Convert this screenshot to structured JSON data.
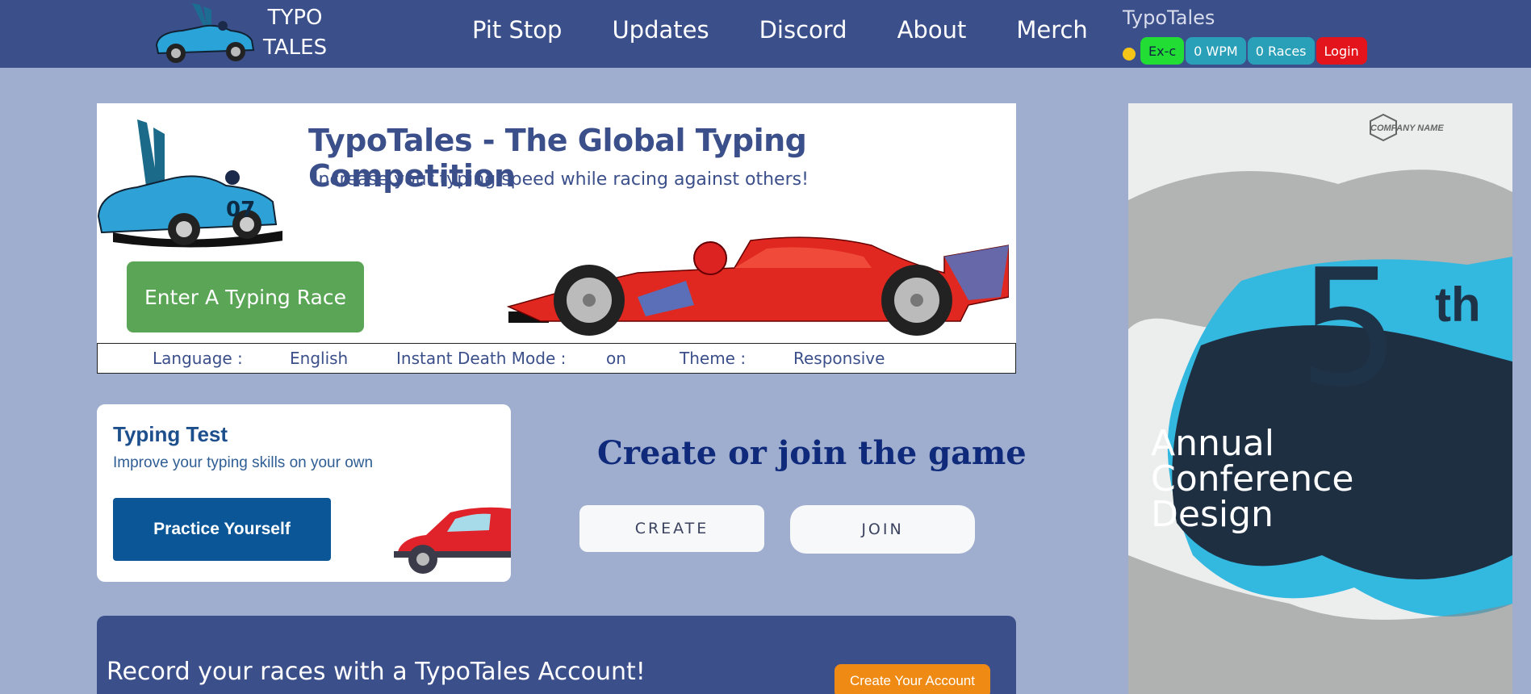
{
  "nav": {
    "logo_line1": "TYPO",
    "logo_line2": "TALES",
    "links": [
      "Pit Stop",
      "Updates",
      "Discord",
      "About",
      "Merch"
    ],
    "user": {
      "name": "TypoTales",
      "status_color": "#f5c518",
      "level": "Ex-c",
      "wpm": "0 WPM",
      "races": "0 Races",
      "login": "Login"
    }
  },
  "hero": {
    "title": "TypoTales - The Global Typing Competition",
    "subtitle": "Increase your typing speed while racing against others!",
    "enter_button": "Enter A Typing Race",
    "settings": {
      "language_label": "Language :",
      "language_value": "English",
      "death_label": "Instant Death Mode :",
      "death_value": "on",
      "theme_label": "Theme :",
      "theme_value": "Responsive"
    }
  },
  "typing_test": {
    "title": "Typing Test",
    "subtitle": "Improve your typing skills on your own",
    "button": "Practice Yourself"
  },
  "game": {
    "title": "Create or join the game",
    "create": "CREATE",
    "join": "JOIN"
  },
  "banner": {
    "text": "Record your races with a TypoTales Account!",
    "button": "Create Your Account"
  },
  "ad": {
    "company": "COMPANY NAME",
    "number": "5",
    "suffix": "th",
    "line1": "Annual",
    "line2": "Conference",
    "line3": "Design"
  },
  "colors": {
    "nav_bg": "#3b4f8a",
    "page_bg": "#9fadce",
    "enter_btn": "#5aa556",
    "practice_btn": "#0b5697",
    "account_btn": "#ef8a14"
  }
}
